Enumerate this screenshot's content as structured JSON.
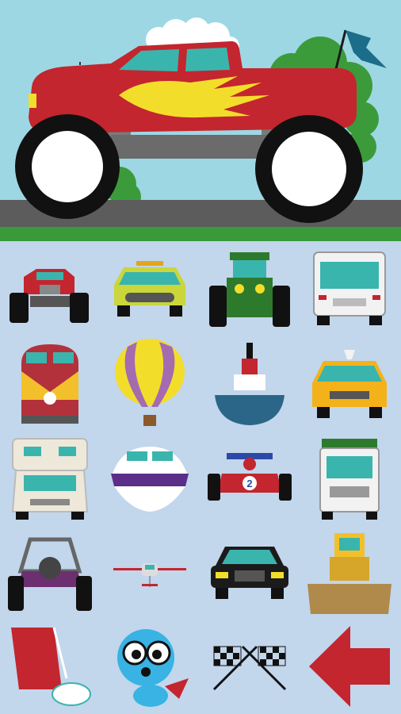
{
  "hero": {
    "vehicle": "monster-truck",
    "colors": {
      "sky": "#9dd7e3",
      "road": "#5c5c5c",
      "grass": "#3a9a3a",
      "truck_body": "#c3262e",
      "flame": "#f3dd2b",
      "window": "#3ab5ad",
      "wheel": "#111111",
      "flag": "#1c6d8a"
    }
  },
  "grid": {
    "background": "#c2d6ec",
    "items": [
      {
        "name": "monster-truck"
      },
      {
        "name": "race-car-yellow"
      },
      {
        "name": "tractor"
      },
      {
        "name": "delivery-truck"
      },
      {
        "name": "train"
      },
      {
        "name": "hot-air-balloon"
      },
      {
        "name": "tugboat"
      },
      {
        "name": "taxi"
      },
      {
        "name": "rv-camper"
      },
      {
        "name": "speedboat"
      },
      {
        "name": "formula-race-car"
      },
      {
        "name": "garbage-truck"
      },
      {
        "name": "dune-buggy"
      },
      {
        "name": "airplane"
      },
      {
        "name": "limousine"
      },
      {
        "name": "bulldozer"
      },
      {
        "name": "paint-roller"
      },
      {
        "name": "mascot-character"
      },
      {
        "name": "checkered-flags"
      },
      {
        "name": "back-arrow"
      }
    ],
    "race_car_number": "2"
  }
}
